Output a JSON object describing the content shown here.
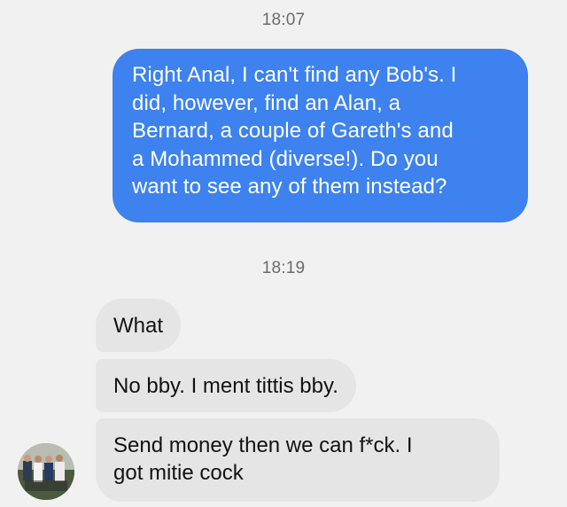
{
  "conversation": {
    "timestamps": [
      "18:07",
      "18:19"
    ],
    "messages": [
      {
        "side": "sent",
        "lines": [
          "Right Anal, I can't find any Bob's. I",
          "did, however, find an Alan, a",
          "Bernard, a couple of Gareth's and",
          "a Mohammed (diverse!). Do you",
          "want to see any of them instead?"
        ]
      },
      {
        "side": "received",
        "lines": [
          "What"
        ]
      },
      {
        "side": "received",
        "lines": [
          "No bby. I ment tittis bby."
        ]
      },
      {
        "side": "received",
        "lines": [
          "Send money then we can f*ck. I",
          "got mitie cock"
        ]
      }
    ]
  },
  "colors": {
    "background": "#f1f1f1",
    "sent_bubble": "#3d82ef",
    "received_bubble": "#e5e5e5",
    "timestamp_text": "#6b6b6b"
  },
  "icons": {
    "contact_avatar": "avatar-photo-icon"
  }
}
